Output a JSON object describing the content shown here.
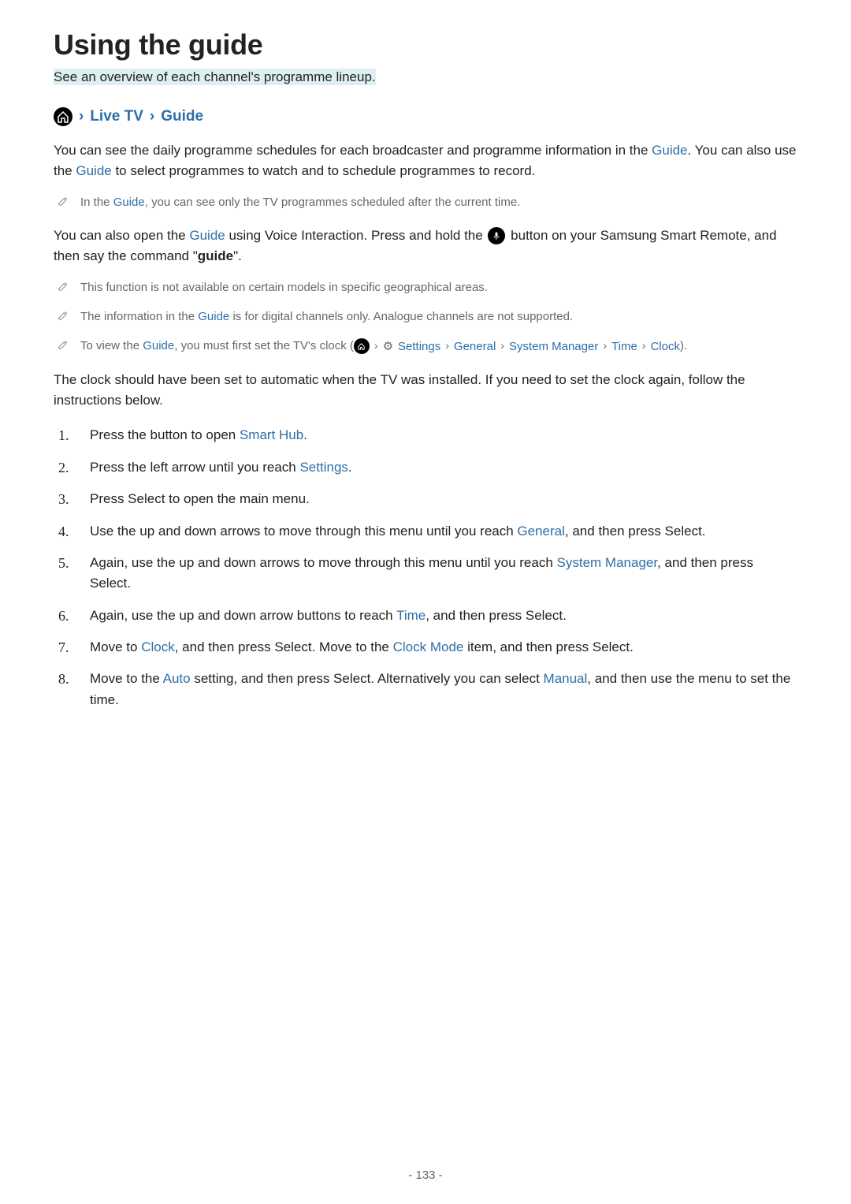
{
  "title": "Using the guide",
  "subtitle": "See an overview of each channel's programme lineup.",
  "breadcrumb": {
    "live_tv": "Live TV",
    "guide": "Guide"
  },
  "para1": {
    "pre": "You can see the daily programme schedules for each broadcaster and programme information in the ",
    "guide1": "Guide",
    "mid": ". You can also use the ",
    "guide2": "Guide",
    "post": " to select programmes to watch and to schedule programmes to record."
  },
  "note1": {
    "pre": "In the ",
    "guide": "Guide",
    "post": ", you can see only the TV programmes scheduled after the current time."
  },
  "para2": {
    "pre": "You can also open the ",
    "guide": "Guide",
    "mid1": " using Voice Interaction. Press and hold the ",
    "mid2": " button on your Samsung Smart Remote, and then say the command \"",
    "cmd": "guide",
    "post": "\"."
  },
  "note2": "This function is not available on certain models in specific geographical areas.",
  "note3": {
    "pre": "The information in the ",
    "guide": "Guide",
    "post": " is for digital channels only. Analogue channels are not supported."
  },
  "note4": {
    "pre": "To view the ",
    "guide": "Guide",
    "mid": ", you must first set the TV's clock (",
    "path": {
      "settings": "Settings",
      "general": "General",
      "system_manager": "System Manager",
      "time": "Time",
      "clock": "Clock"
    },
    "post": ")."
  },
  "para3": "The clock should have been set to automatic when the TV was installed. If you need to set the clock again, follow the instructions below.",
  "steps": {
    "s1": {
      "pre": "Press the button to open ",
      "link": "Smart Hub",
      "post": "."
    },
    "s2": {
      "pre": "Press the left arrow until you reach ",
      "link": "Settings",
      "post": "."
    },
    "s3": {
      "text": "Press Select to open the main menu."
    },
    "s4": {
      "pre": "Use the up and down arrows to move through this menu until you reach ",
      "link": "General",
      "post": ", and then press Select."
    },
    "s5": {
      "pre": "Again, use the up and down arrows to move through this menu until you reach ",
      "link": "System Manager",
      "post": ", and then press Select."
    },
    "s6": {
      "pre": "Again, use the up and down arrow buttons to reach ",
      "link": "Time",
      "post": ", and then press Select."
    },
    "s7": {
      "pre": "Move to ",
      "link1": "Clock",
      "mid": ", and then press Select. Move to the ",
      "link2": "Clock Mode",
      "post": " item, and then press Select."
    },
    "s8": {
      "pre": "Move to the ",
      "link1": "Auto",
      "mid": " setting, and then press Select. Alternatively you can select ",
      "link2": "Manual",
      "post": ", and then use the menu to set the time."
    }
  },
  "page_number": "- 133 -"
}
